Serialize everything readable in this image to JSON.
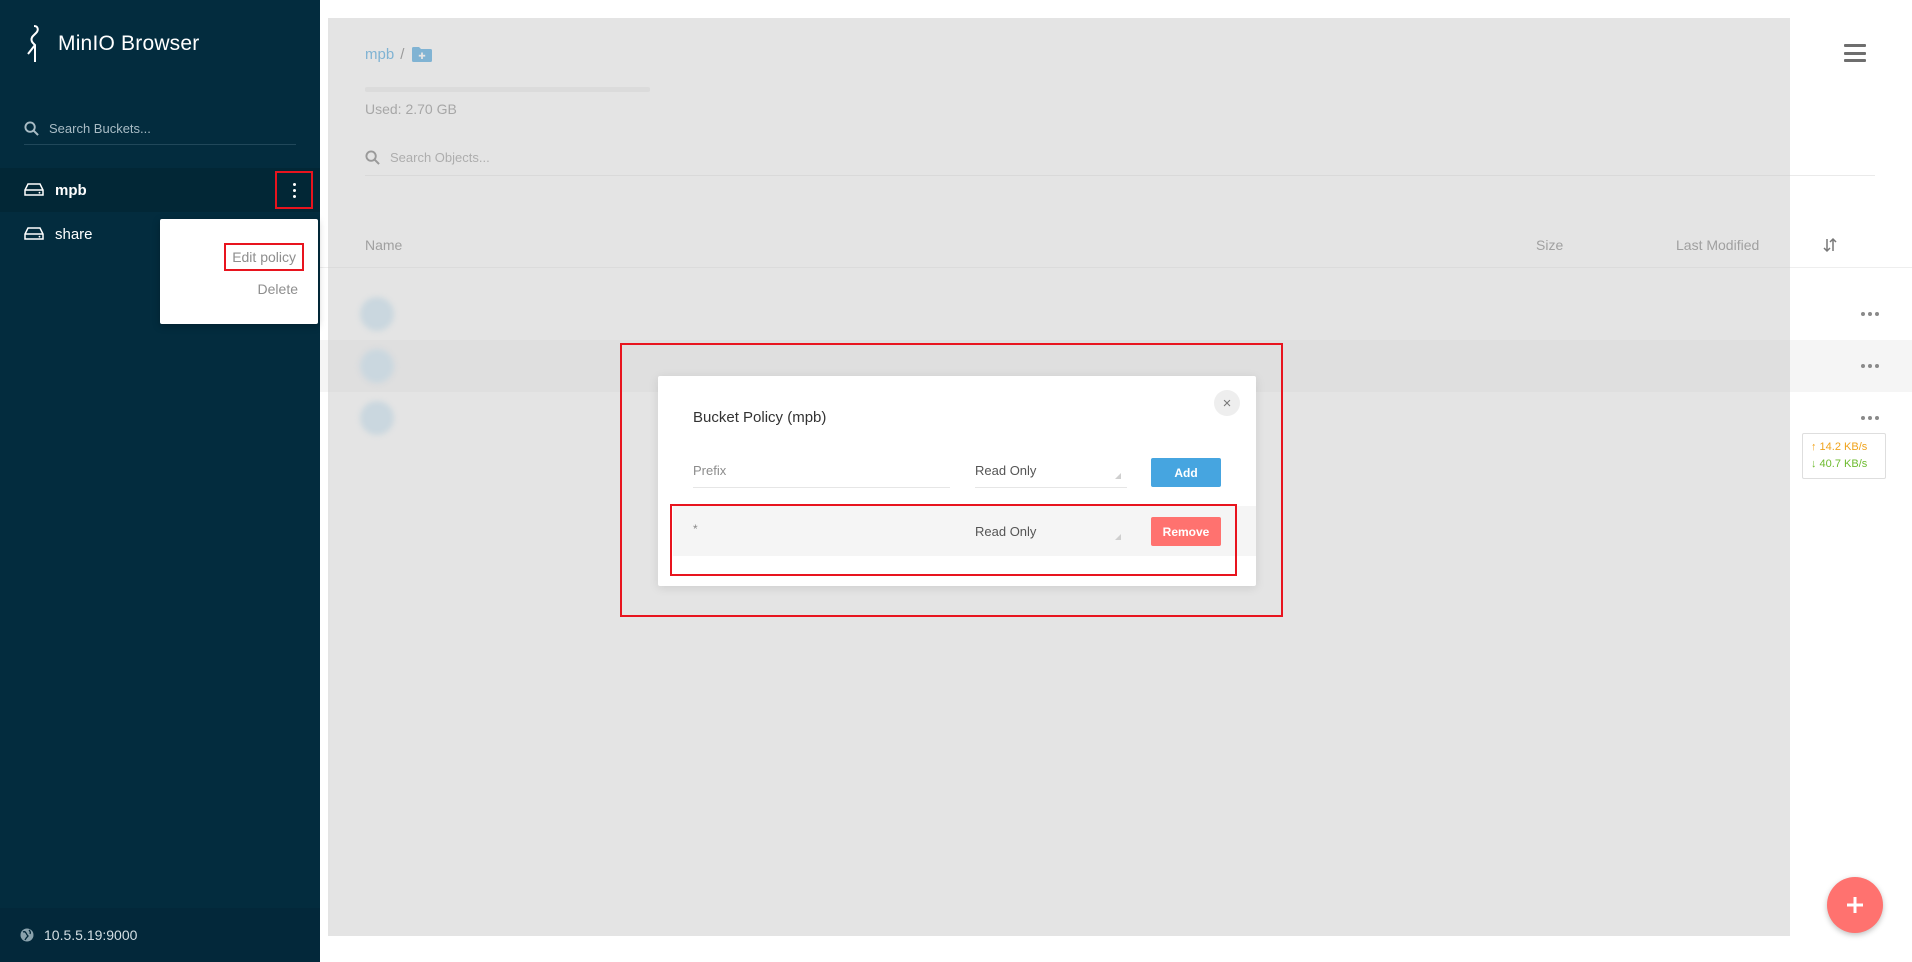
{
  "sidebar": {
    "brand": "MinIO Browser",
    "search_placeholder": "Search Buckets...",
    "buckets": [
      {
        "name": "mpb",
        "active": true
      },
      {
        "name": "share",
        "active": false
      }
    ],
    "bucket_menu": {
      "edit_policy": "Edit policy",
      "delete": "Delete"
    },
    "host": "10.5.5.19:9000"
  },
  "main": {
    "breadcrumb": {
      "bucket": "mpb",
      "separator": "/"
    },
    "usage": {
      "text": "Used: 2.70 GB",
      "fraction": 0.0
    },
    "search_placeholder": "Search Objects...",
    "columns": {
      "name": "Name",
      "size": "Size",
      "last_modified": "Last Modified"
    },
    "speed": {
      "upload": "↑ 14.2 KB/s",
      "download": "↓ 40.7 KB/s"
    }
  },
  "modal": {
    "title": "Bucket Policy (mpb)",
    "prefix_placeholder": "Prefix",
    "new_policy_value": "Read Only",
    "add_label": "Add",
    "policies": [
      {
        "prefix": "*",
        "policy": "Read Only",
        "remove_label": "Remove"
      }
    ],
    "close_glyph": "×"
  },
  "colors": {
    "sidebar_bg": "#032c3e",
    "accent_blue": "#46a5e0",
    "accent_red": "#ff726f",
    "highlight": "#e8141e"
  }
}
